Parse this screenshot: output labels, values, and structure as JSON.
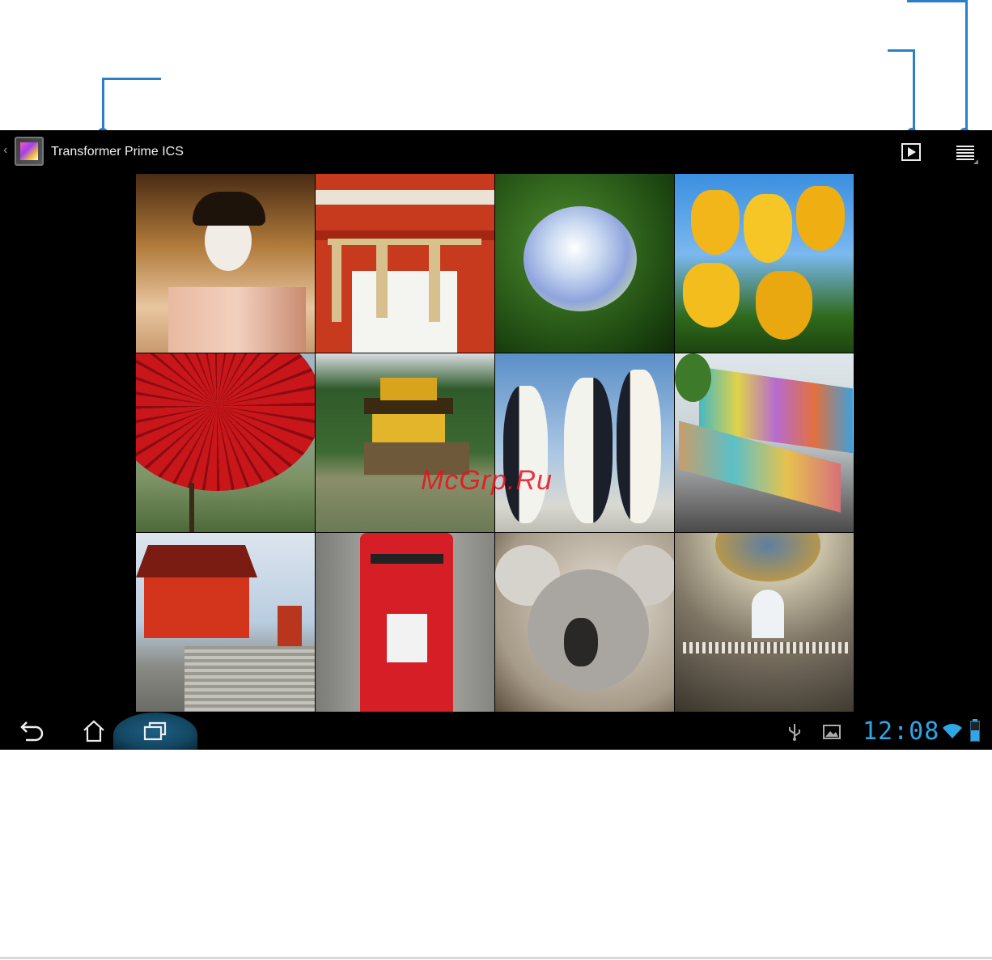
{
  "app": {
    "title": "Transformer Prime ICS"
  },
  "actions": {
    "slideshow_icon": "slideshow-icon",
    "menu_icon": "overflow-menu-icon"
  },
  "status": {
    "time": "12:08",
    "icons": [
      "usb-icon",
      "gallery-notification-icon",
      "wifi-icon",
      "battery-icon"
    ]
  },
  "watermark": "McGrp.Ru",
  "accent_color": "#2fa6e6",
  "callout_color": "#2a7fc9",
  "photos": [
    "geisha",
    "torii-ropes",
    "hydrangea",
    "tulips",
    "red-umbrella",
    "golden-pavilion",
    "penguins",
    "painted-bench",
    "red-temple",
    "post-box",
    "koala",
    "dome-interior"
  ]
}
